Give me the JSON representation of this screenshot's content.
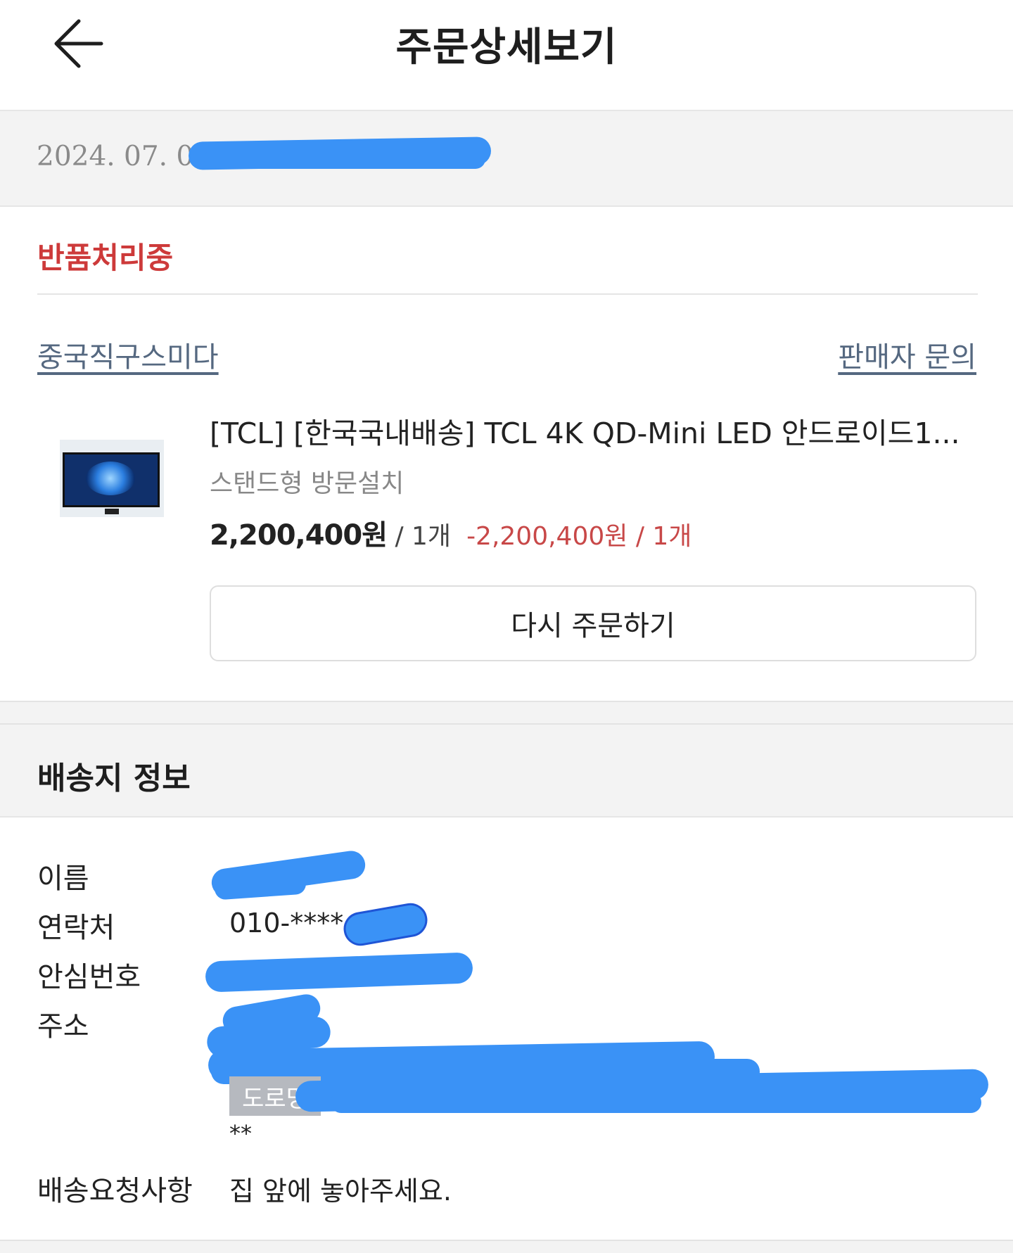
{
  "header": {
    "back_icon": "arrow-left-icon",
    "title": "주문상세보기"
  },
  "order": {
    "date": "2024. 07. 09"
  },
  "status": {
    "label": "반품처리중",
    "color": "#cd3a3a"
  },
  "seller": {
    "name": "중국직구스미다",
    "inquiry_label": "판매자 문의"
  },
  "product": {
    "thumbnail_icon": "tv-product-image",
    "name": "[TCL] [한국국내배송] TCL 4K QD-Mini LED 안드로이드1...",
    "option": "스탠드형 방문설치",
    "price": "2,200,400원",
    "qty": " / 1개",
    "refund": "-2,200,400원 / 1개",
    "reorder_label": "다시 주문하기"
  },
  "shipping": {
    "title": "배송지 정보",
    "name_label": "이름",
    "phone_label": "연락처",
    "phone_value": "010-****",
    "safe_number_label": "안심번호",
    "address_label": "주소",
    "road_badge": "도로명",
    "address_tail": "**",
    "request_label": "배송요청사항",
    "request_value": "집 앞에 놓아주세요."
  },
  "colors": {
    "accent_red": "#cd3a3a",
    "link": "#556880",
    "redaction": "#3a92f6"
  }
}
